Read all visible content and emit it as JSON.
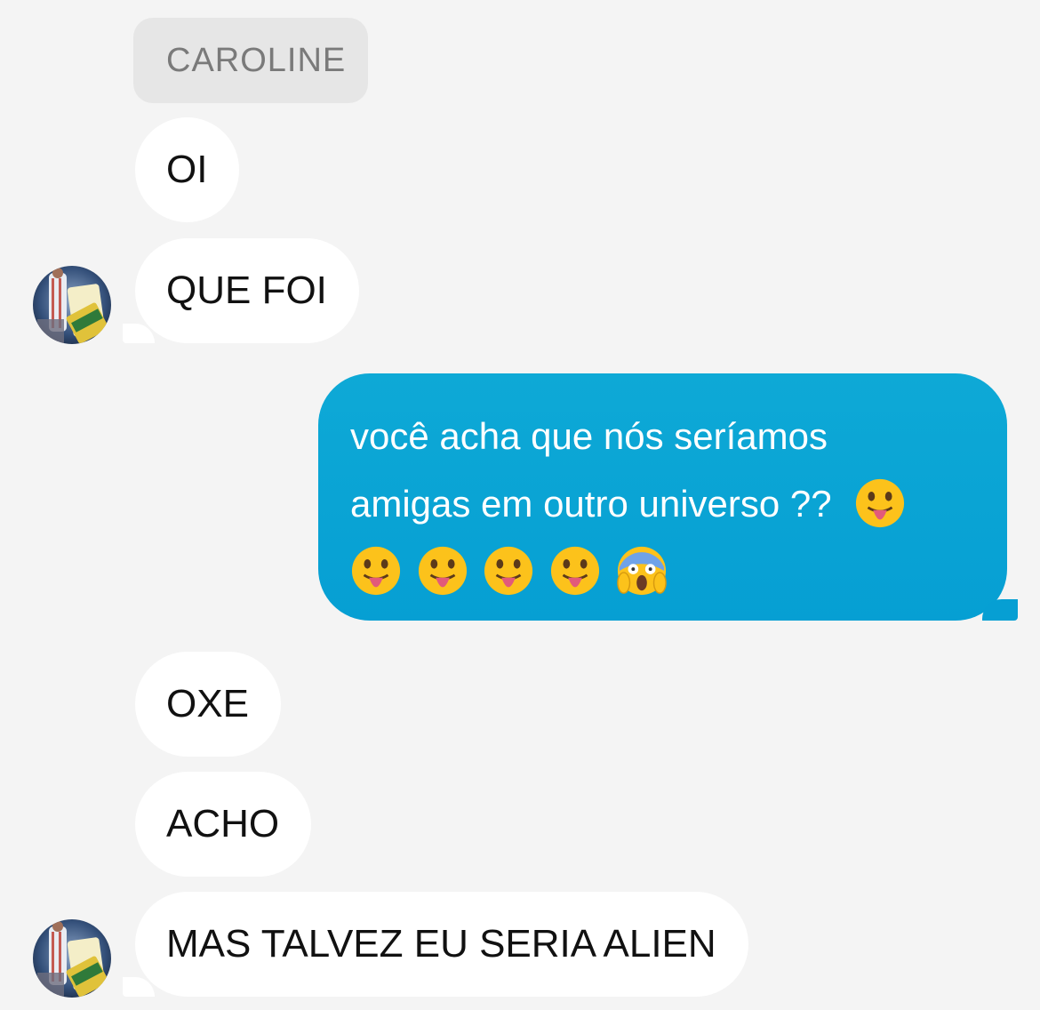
{
  "contact": {
    "name_tag": "CAROLINE"
  },
  "messages": [
    {
      "sender": "them",
      "text": "OI"
    },
    {
      "sender": "them",
      "text": "QUE FOI"
    },
    {
      "sender": "me",
      "text_line1": "você acha que nós seríamos",
      "text_line2": "amigas em outro universo ??",
      "emoji_line2": [
        "face-with-tongue"
      ],
      "emoji_line3": [
        "face-with-tongue",
        "face-with-tongue",
        "face-with-tongue",
        "face-with-tongue",
        "face-screaming-in-fear"
      ]
    },
    {
      "sender": "them",
      "text": "OXE"
    },
    {
      "sender": "them",
      "text": "ACHO"
    },
    {
      "sender": "them",
      "text": "MAS TALVEZ EU SERIA ALIEN"
    }
  ],
  "colors": {
    "background": "#f4f4f4",
    "incoming_bubble": "#ffffff",
    "outgoing_bubble": "#069fd3",
    "name_tag_bg": "#e6e6e6",
    "name_tag_text": "#7a7a7a"
  },
  "icons": {
    "avatar": "contact-avatar-photo"
  }
}
